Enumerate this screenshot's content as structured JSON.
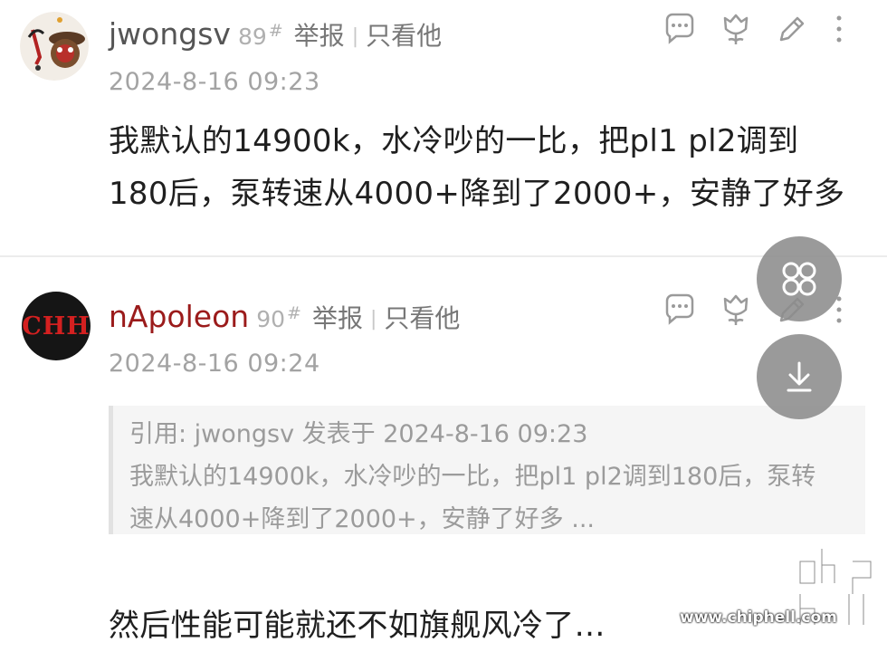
{
  "posts": [
    {
      "username": "jwongsv",
      "floor": "89",
      "floor_mark": "#",
      "report_label": "举报",
      "only_view_label": "只看他",
      "date": "2024-8-16 09:23",
      "content_lines": [
        "我默认的14900k，水冷吵的一比，把pl1 pl2调到",
        "180后，泵转速从4000+降到了2000+，安静了好多"
      ]
    },
    {
      "username": "nApoleon",
      "avatar_text": "CHH",
      "floor": "90",
      "floor_mark": "#",
      "report_label": "举报",
      "only_view_label": "只看他",
      "date": "2024-8-16 09:24",
      "quote_lines": [
        "引用: jwongsv 发表于 2024-8-16 09:23",
        "我默认的14900k，水冷吵的一比，把pl1 pl2调到180后，泵转",
        "速从4000+降到了2000+，安静了好多 ..."
      ],
      "content": "然后性能可能就还不如旗舰风冷了…"
    }
  ],
  "separator": "|",
  "icons": {
    "comment": "comment-icon",
    "like": "tulip-like-icon",
    "edit": "pencil-edit-icon",
    "more": "more-vertical-icon",
    "grid": "grid-menu-icon",
    "download": "download-icon"
  },
  "watermark": {
    "logo_text": "chip hell",
    "url": "www.chiphell.com"
  },
  "colors": {
    "username1": "#555555",
    "username2": "#9b1b1b",
    "fab": "#8c8c8c"
  }
}
